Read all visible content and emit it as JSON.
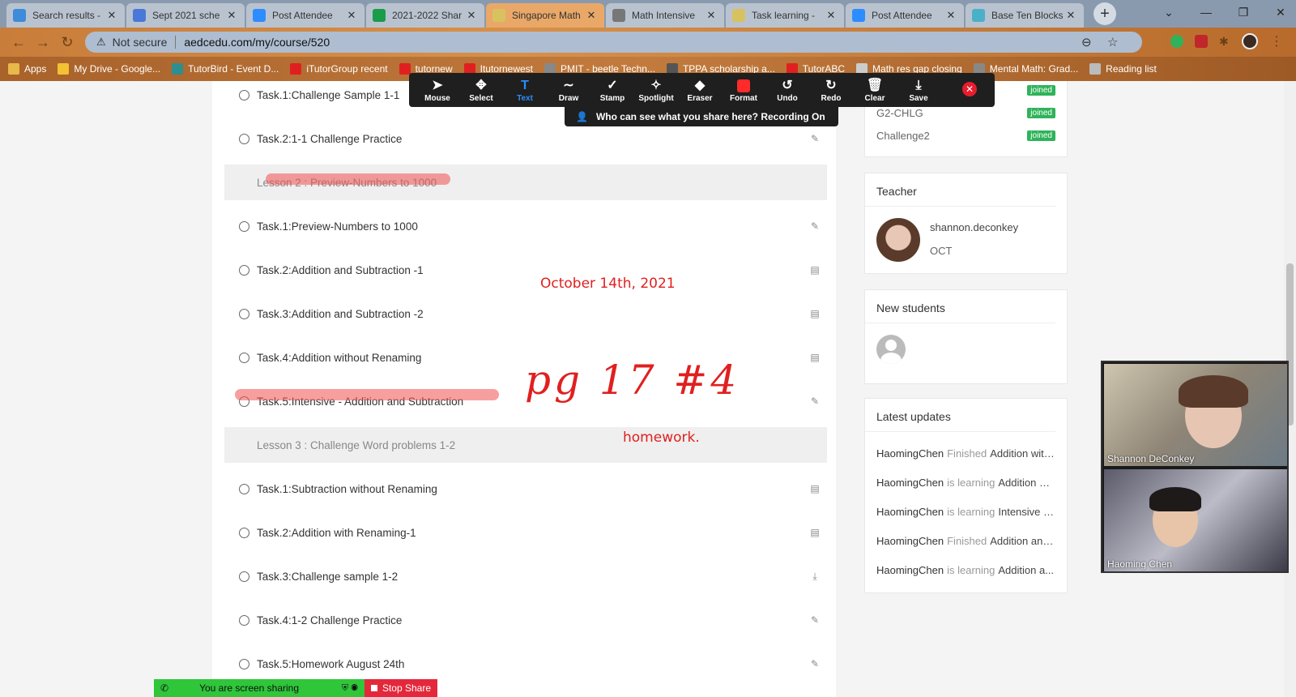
{
  "browser": {
    "tabs": [
      {
        "label": "Search results -",
        "color": "#3d8bd9",
        "active": false
      },
      {
        "label": "Sept 2021 sche",
        "color": "#4a78d8",
        "active": false
      },
      {
        "label": "Post Attendee",
        "color": "#2d8cff",
        "active": false
      },
      {
        "label": "2021-2022 Shar",
        "color": "#1a9c4a",
        "active": false
      },
      {
        "label": "Singapore Math",
        "color": "#d8c260",
        "active": true
      },
      {
        "label": "Math Intensive",
        "color": "#777777",
        "active": false
      },
      {
        "label": "Task learning -",
        "color": "#d8c260",
        "active": false
      },
      {
        "label": "Post Attendee",
        "color": "#2d8cff",
        "active": false
      },
      {
        "label": "Base Ten Blocks",
        "color": "#4ab0c8",
        "active": false
      }
    ],
    "security_label": "Not secure",
    "url": "aedcedu.com/my/course/520",
    "bookmarks": [
      {
        "label": "Apps",
        "color": "#e8b84a"
      },
      {
        "label": "My Drive - Google...",
        "color": "#f2c233"
      },
      {
        "label": "TutorBird - Event D...",
        "color": "#2d8f8f"
      },
      {
        "label": "iTutorGroup recent",
        "color": "#e02020"
      },
      {
        "label": "tutornew",
        "color": "#e02020"
      },
      {
        "label": "Itutornewest",
        "color": "#e02020"
      },
      {
        "label": "PMIT - beetle Techn...",
        "color": "#888888"
      },
      {
        "label": "TPPA scholarship a...",
        "color": "#555555"
      },
      {
        "label": "TutorABC",
        "color": "#e02020"
      },
      {
        "label": "Math res gap closing",
        "color": "#cccccc"
      },
      {
        "label": "Mental Math: Grad...",
        "color": "#888888"
      },
      {
        "label": "Reading list",
        "color": "#bbbbbb"
      }
    ]
  },
  "lessons": {
    "items": [
      {
        "kind": "task",
        "label": "Task.1:Challenge Sample 1-1",
        "icon": "pencil-icon"
      },
      {
        "kind": "task",
        "label": "Task.2:1-1 Challenge Practice",
        "icon": "pencil-icon"
      },
      {
        "kind": "lesson",
        "label": "Lesson 2 : Preview-Numbers to 1000"
      },
      {
        "kind": "task",
        "label": "Task.1:Preview-Numbers to 1000",
        "icon": "pencil-icon"
      },
      {
        "kind": "task",
        "label": "Task.2:Addition and Subtraction -1",
        "icon": "document-icon"
      },
      {
        "kind": "task",
        "label": "Task.3:Addition and Subtraction -2",
        "icon": "document-icon"
      },
      {
        "kind": "task",
        "label": "Task.4:Addition without Renaming",
        "icon": "document-icon"
      },
      {
        "kind": "task",
        "label": "Task.5:Intensive - Addition and Subtraction",
        "icon": "pencil-icon"
      },
      {
        "kind": "lesson",
        "label": "Lesson 3 : Challenge Word problems 1-2"
      },
      {
        "kind": "task",
        "label": "Task.1:Subtraction without Renaming",
        "icon": "document-icon"
      },
      {
        "kind": "task",
        "label": "Task.2:Addition with Renaming-1",
        "icon": "document-icon"
      },
      {
        "kind": "task",
        "label": "Task.3:Challenge sample 1-2",
        "icon": "download-icon"
      },
      {
        "kind": "task",
        "label": "Task.4:1-2 Challenge Practice",
        "icon": "pencil-icon"
      },
      {
        "kind": "task",
        "label": "Task.5:Homework August 24th",
        "icon": "pencil-icon"
      }
    ]
  },
  "annotations": {
    "date": "October 14th, 2021",
    "page": "pg 17 #4",
    "homework": "homework."
  },
  "sidebar": {
    "joined": [
      {
        "label": "",
        "badge": "joined"
      },
      {
        "label": "G2-CHLG",
        "badge": "joined"
      },
      {
        "label": "Challenge2",
        "badge": "joined"
      }
    ],
    "teacher_title": "Teacher",
    "teacher_name": "shannon.deconkey",
    "teacher_sub": "OCT",
    "new_students_title": "New students",
    "latest_updates_title": "Latest updates",
    "updates": [
      {
        "name": "HaomingChen",
        "verb": "Finished",
        "text": "Addition with..."
      },
      {
        "name": "HaomingChen",
        "verb": "is learning",
        "text": "Addition wi..."
      },
      {
        "name": "HaomingChen",
        "verb": "is learning",
        "text": "Intensive - ..."
      },
      {
        "name": "HaomingChen",
        "verb": "Finished",
        "text": "Addition and..."
      },
      {
        "name": "HaomingChen",
        "verb": "is learning",
        "text": "Addition a..."
      }
    ]
  },
  "zoom_toolbar": {
    "tools": [
      {
        "label": "Mouse",
        "icon": "cursor-icon"
      },
      {
        "label": "Select",
        "icon": "move-icon"
      },
      {
        "label": "Text",
        "icon": "text-icon",
        "active": true
      },
      {
        "label": "Draw",
        "icon": "draw-icon"
      },
      {
        "label": "Stamp",
        "icon": "stamp-icon"
      },
      {
        "label": "Spotlight",
        "icon": "spotlight-icon"
      },
      {
        "label": "Eraser",
        "icon": "eraser-icon"
      },
      {
        "label": "Format",
        "icon": "format-icon"
      },
      {
        "label": "Undo",
        "icon": "undo-icon"
      },
      {
        "label": "Redo",
        "icon": "redo-icon"
      },
      {
        "label": "Clear",
        "icon": "trash-icon"
      },
      {
        "label": "Save",
        "icon": "save-icon"
      }
    ],
    "banner": "Who can see what you share here? Recording On",
    "accent": "#2a8cff"
  },
  "share_bar": {
    "status": "You are screen sharing",
    "stop_label": "Stop Share"
  },
  "video": {
    "participants": [
      {
        "name": "Shannon DeConkey"
      },
      {
        "name": "Haoming Chen"
      }
    ]
  }
}
